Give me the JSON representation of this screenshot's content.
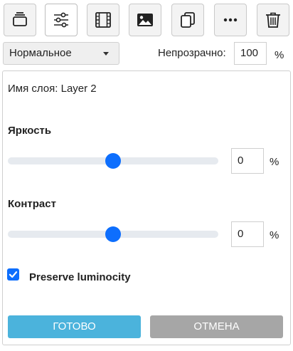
{
  "toolbar": {
    "buttons": [
      {
        "icon": "layers-icon"
      },
      {
        "icon": "sliders-icon",
        "active": true
      },
      {
        "icon": "film-icon"
      },
      {
        "icon": "image-icon"
      },
      {
        "icon": "duplicate-icon"
      },
      {
        "icon": "more-icon"
      },
      {
        "icon": "trash-icon"
      }
    ]
  },
  "blend": {
    "value": "Нормальное"
  },
  "opacity": {
    "label": "Непрозрачно:",
    "value": "100",
    "unit": "%"
  },
  "layer": {
    "name_label": "Имя слоя: Layer 2"
  },
  "brightness": {
    "label": "Яркость",
    "value": "0",
    "unit": "%",
    "slider_fraction": 0.5
  },
  "contrast": {
    "label": "Контраст",
    "value": "0",
    "unit": "%",
    "slider_fraction": 0.5
  },
  "preserve": {
    "label": "Preserve luminocity",
    "checked": true
  },
  "actions": {
    "ok_label": "ГОТОВО",
    "cancel_label": "ОТМЕНА"
  },
  "colors": {
    "accent": "#0d6efd",
    "ok": "#4bb3dc",
    "cancel": "#a6a6a6"
  }
}
